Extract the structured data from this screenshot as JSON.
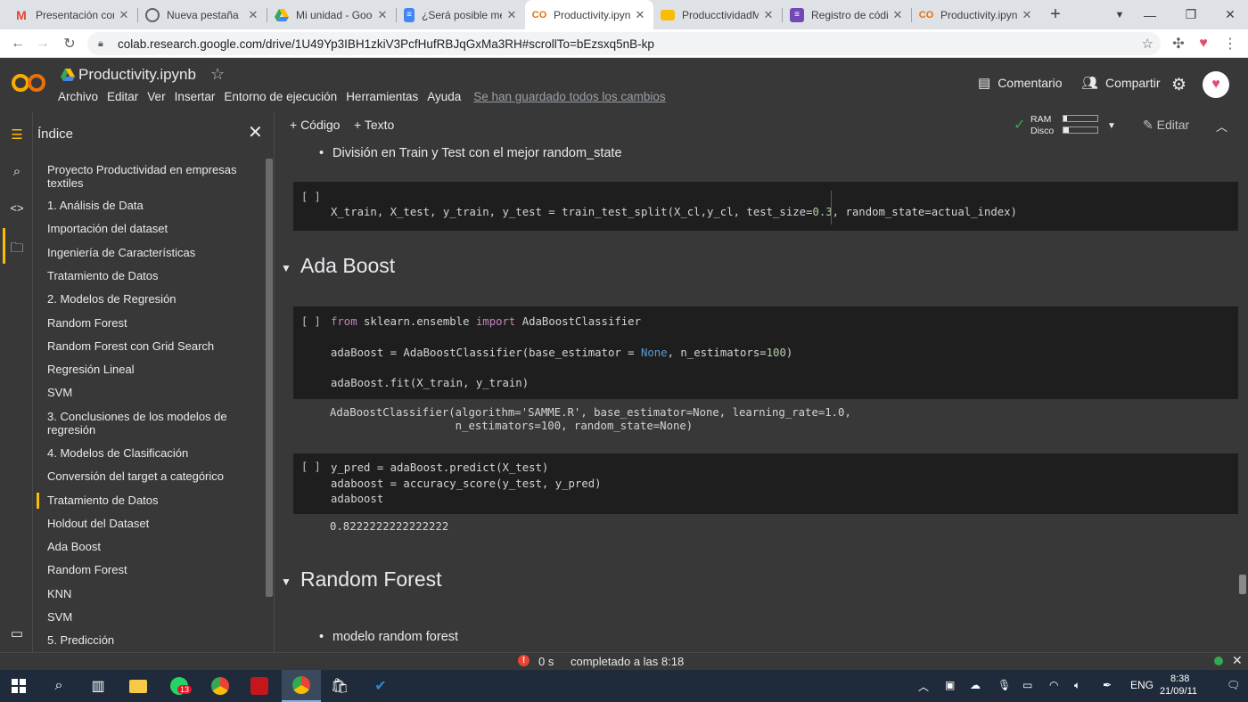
{
  "browser": {
    "tabs": [
      {
        "title": "Presentación com",
        "icon": "gmail-icon",
        "color": "#ea4335"
      },
      {
        "title": "Nueva pestaña",
        "icon": "chrome-icon",
        "color": "#5f6368"
      },
      {
        "title": "Mi unidad - Goog",
        "icon": "drive-icon",
        "color": "#34a853"
      },
      {
        "title": "¿Será posible mej",
        "icon": "docs-icon",
        "color": "#4285f4"
      },
      {
        "title": "Productivity.ipynb",
        "icon": "colab-icon",
        "color": "#e8710a"
      },
      {
        "title": "ProducctividadMl",
        "icon": "slides-icon",
        "color": "#fbbc04"
      },
      {
        "title": "Registro de códig",
        "icon": "forms-icon",
        "color": "#7248b9"
      },
      {
        "title": "Productivity.ipynb",
        "icon": "colab-icon",
        "color": "#e8710a"
      }
    ],
    "url": "colab.research.google.com/drive/1U49Yp3IBH1zkiV3PcfHufRBJqGxMa3RH#scrollTo=bEzsxq5nB-kp"
  },
  "colab": {
    "logo": "CO",
    "notebook_title": "Productivity.ipynb",
    "menu": [
      "Archivo",
      "Editar",
      "Ver",
      "Insertar",
      "Entorno de ejecución",
      "Herramientas",
      "Ayuda"
    ],
    "saved_status": "Se han guardado todos los cambios",
    "comment_label": "Comentario",
    "share_label": "Compartir",
    "add_code_label": "+ Código",
    "add_text_label": "+ Texto",
    "ram_label": "RAM",
    "disk_label": "Disco",
    "ram_usage": 0.1,
    "disk_usage": 0.15,
    "edit_label": "Editar"
  },
  "toc": {
    "title": "Índice",
    "items": [
      "Proyecto Productividad en empresas textiles",
      "1. Análisis de Data",
      "Importación del dataset",
      "Ingeniería de Características",
      "Tratamiento de Datos",
      "2. Modelos de Regresión",
      "Random Forest",
      "Random Forest con Grid Search",
      "Regresión Lineal",
      "SVM",
      "3. Conclusiones de los modelos de regresión",
      "4. Modelos de Clasificación",
      "Conversión del target a categórico",
      "Tratamiento de Datos",
      "Holdout del Dataset",
      "Ada Boost",
      "Random Forest",
      "KNN",
      "SVM",
      "5. Predicción"
    ]
  },
  "notebook": {
    "bullet1": "División en Train y Test con el mejor random_state",
    "run_marker": "[ ]",
    "cell1_code": "X_train, X_test, y_train, y_test = train_test_split(X_cl,y_cl, test_size=0.3, random_state=actual_index)",
    "cell1_pre": "X_train, X_test, y_train, y_test = train_test_split(X_cl,y_cl, test_size=",
    "cell1_num": "0.3",
    "cell1_post": ", random_state=actual_index)",
    "section1": "Ada Boost",
    "cell2_kw1": "from",
    "cell2_mod": " sklearn.ensemble ",
    "cell2_kw2": "import",
    "cell2_cls": " AdaBoostClassifier",
    "cell2_l2a": "adaBoost = AdaBoostClassifier(base_estimator = ",
    "cell2_l2b": "None",
    "cell2_l2c": ", n_estimators=",
    "cell2_l2d": "100",
    "cell2_l2e": ")",
    "cell2_l3": "adaBoost.fit(X_train, y_train)",
    "cell2_output": "AdaBoostClassifier(algorithm='SAMME.R', base_estimator=None, learning_rate=1.0,\n                   n_estimators=100, random_state=None)",
    "cell3_code": "y_pred = adaBoost.predict(X_test)\nadaboost = accuracy_score(y_test, y_pred)\nadaboost",
    "cell3_output": "0.8222222222222222",
    "section2": "Random Forest",
    "bullet2": "modelo random forest"
  },
  "status": {
    "time": "0 s",
    "message": "completado a las 8:18"
  },
  "taskbar": {
    "whatsapp_badge": "13",
    "language": "ENG",
    "clock_time": "8:38",
    "clock_date": "21/09/11"
  }
}
